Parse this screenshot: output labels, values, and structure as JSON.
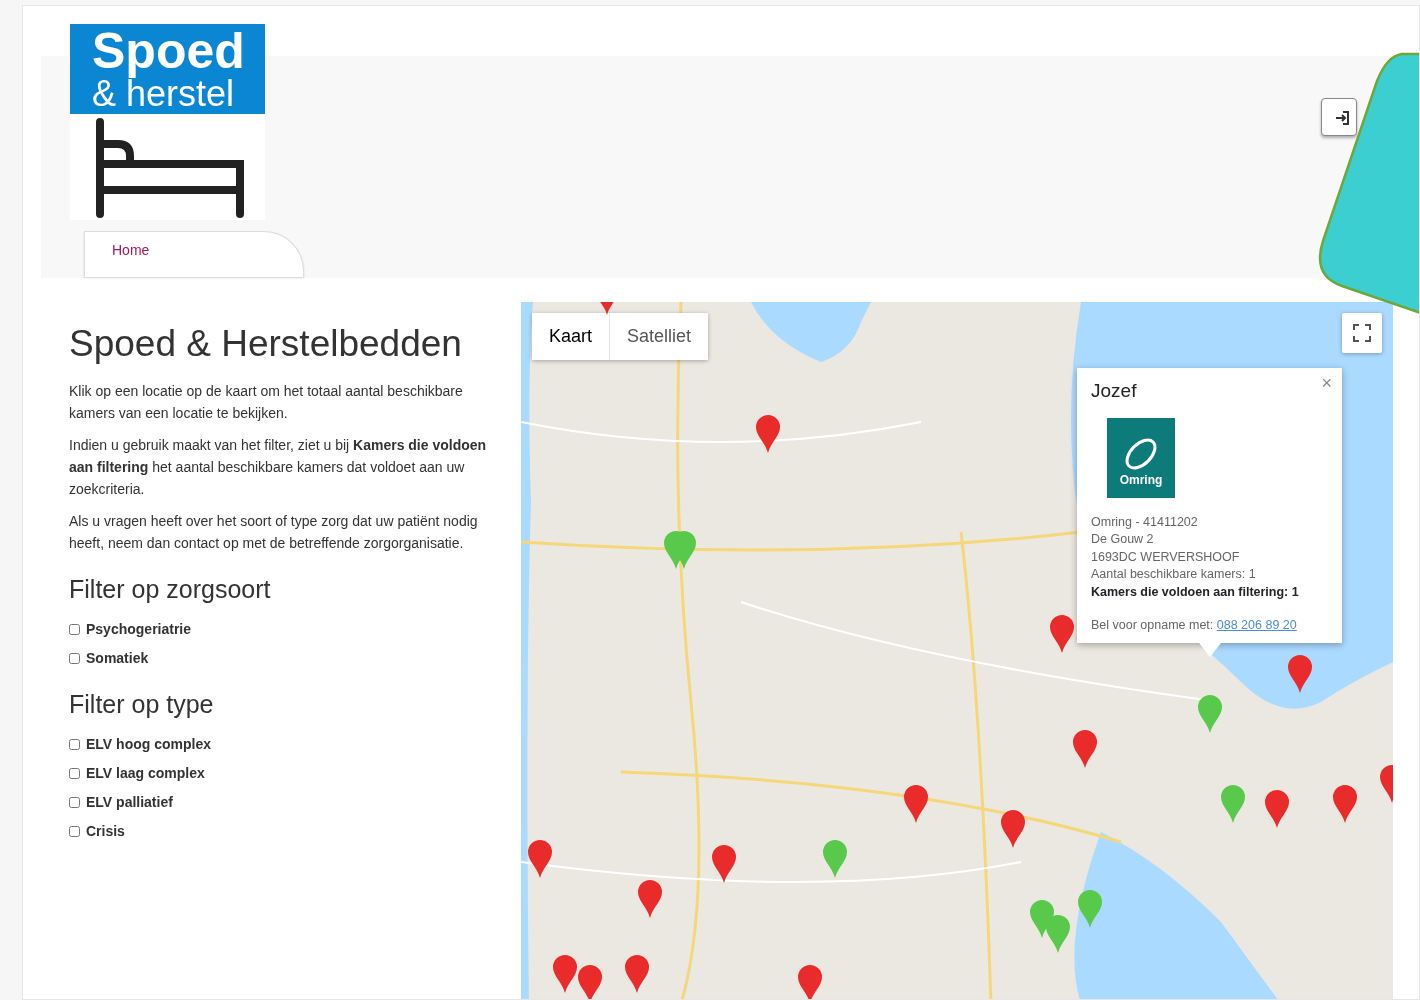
{
  "logo": {
    "line_1": "Spoed",
    "line_2": "& herstel"
  },
  "nav": [
    {
      "label": "Home",
      "selected": true
    }
  ],
  "title": "Spoed & Herstelbedden",
  "paragraphs": [
    "Klik op een locatie op de kaart om het totaal aantal beschikbare kamers van een locatie te bekijken.",
    "Indien u gebruik maakt van het filter, ziet u bij **Kamers die voldoen aan filtering** het aantal beschikbare kamers dat voldoet aan uw zoekcriteria.",
    "Als u vragen heeft over het soort of type zorg dat uw patiënt nodig heeft, neem dan contact op met de betreffende zorgorganisatie."
  ],
  "filters": [
    {
      "heading": "Filter op zorgsoort",
      "options": [
        {
          "label": "Psychogeriatrie",
          "checked": false
        },
        {
          "label": "Somatiek",
          "checked": false
        }
      ]
    },
    {
      "heading": "Filter op type",
      "options": [
        {
          "label": "ELV hoog complex",
          "checked": false
        },
        {
          "label": "ELV laag complex",
          "checked": false
        },
        {
          "label": "ELV palliatief",
          "checked": false
        },
        {
          "label": "Crisis",
          "checked": false
        }
      ]
    }
  ],
  "map": {
    "map_types": [
      {
        "label": "Kaart",
        "selected": true
      },
      {
        "label": "Satelliet",
        "selected": false
      }
    ],
    "markers": [
      {
        "color": "#ea2b2b"
      },
      {
        "color": "#ea2b2b"
      },
      {
        "color": "#59c94c"
      },
      {
        "color": "#ea2b2b"
      },
      {
        "color": "#ea2b2b"
      },
      {
        "color": "#ea2b2b"
      },
      {
        "color": "#ea2b2b"
      },
      {
        "color": "#ea2b2b"
      },
      {
        "color": "#ea2b2b"
      },
      {
        "color": "#ea2b2b"
      },
      {
        "color": "#ea2b2b"
      },
      {
        "color": "#ea2b2b"
      },
      {
        "color": "#ea2b2b"
      },
      {
        "color": "#ea2b2b"
      },
      {
        "color": "#ea2b2b"
      },
      {
        "color": "#ea2b2b"
      },
      {
        "color": "#ea2b2b"
      },
      {
        "color": "#ea2b2b"
      },
      {
        "color": "#59c94c"
      },
      {
        "color": "#59c94c"
      },
      {
        "color": "#59c94c"
      },
      {
        "color": "#59c94c"
      },
      {
        "color": "#59c94c"
      },
      {
        "color": "#59c94c"
      },
      {
        "color": "#59c94c"
      }
    ],
    "popup": {
      "close_label": "×",
      "title": "Jozef",
      "logo_text": "Omring",
      "lines": [
        "Omring - 41411202",
        "De Gouw 2",
        "1693DC WERVERSHOOF",
        "Aantal beschikbare kamers: 1"
      ],
      "filter_line": "Kamers die voldoen aan filtering: 1",
      "call_label": "Bel voor opname met:",
      "phone": "088 206 89 20"
    }
  }
}
